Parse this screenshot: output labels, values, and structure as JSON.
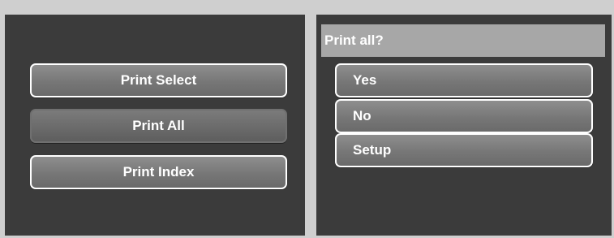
{
  "left_menu": {
    "items": [
      {
        "label": "Print Select"
      },
      {
        "label": "Print All"
      },
      {
        "label": "Print Index"
      }
    ]
  },
  "dialog": {
    "title": "Print all?",
    "options": [
      {
        "label": "Yes"
      },
      {
        "label": "No"
      },
      {
        "label": "Setup"
      }
    ]
  }
}
